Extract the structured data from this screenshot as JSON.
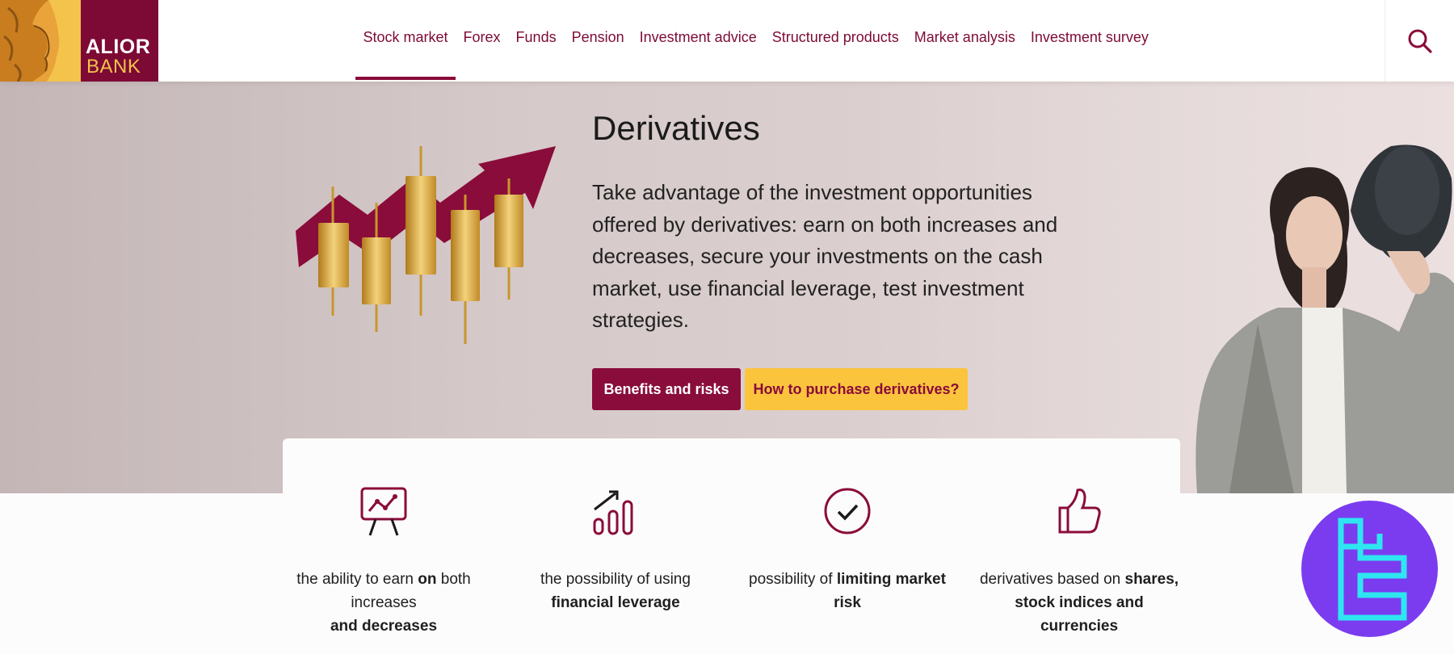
{
  "logo": {
    "line1": "ALIOR",
    "line2": "BANK"
  },
  "nav": {
    "items": [
      {
        "label": "Stock market",
        "active": true
      },
      {
        "label": "Forex"
      },
      {
        "label": "Funds"
      },
      {
        "label": "Pension"
      },
      {
        "label": "Investment advice"
      },
      {
        "label": "Structured products"
      },
      {
        "label": "Market analysis"
      },
      {
        "label": "Investment survey"
      }
    ],
    "search_icon": "search-icon"
  },
  "hero": {
    "title": "Derivatives",
    "description": "Take advantage of the investment opportunities offered by derivatives: earn on both increases and decreases, secure your investments on the cash market, use financial leverage, test investment strategies.",
    "primary_button": "Benefits and risks",
    "secondary_button": "How to purchase derivatives?"
  },
  "features": [
    {
      "icon": "presentation-chart-icon",
      "parts": [
        "the ability to earn ",
        "on",
        " both increases ",
        "and decreases",
        ""
      ]
    },
    {
      "icon": "bar-growth-icon",
      "parts": [
        "the possibility of using ",
        "financial leverage",
        ""
      ]
    },
    {
      "icon": "check-circle-icon",
      "parts": [
        "possibility of ",
        "limiting market risk",
        ""
      ]
    },
    {
      "icon": "thumbs-up-icon",
      "parts": [
        "derivatives based on ",
        "shares, stock indices and currencies",
        ""
      ]
    }
  ],
  "colors": {
    "brand": "#8a0c3a",
    "accent": "#fbc43d",
    "badge": "#7b3cf0",
    "badge_mark": "#2ee6f0"
  }
}
